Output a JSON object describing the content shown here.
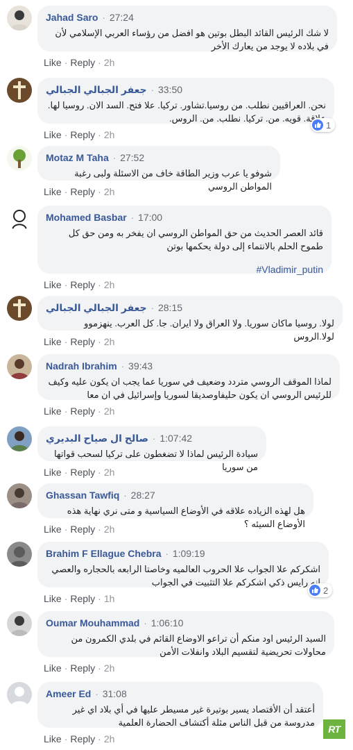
{
  "actions": {
    "like": "Like",
    "reply": "Reply"
  },
  "brand": {
    "like_badge_color": "#4a7ef6",
    "rt_color": "#6db33f",
    "rt_label": "RT"
  },
  "comments": [
    {
      "name": "Jahad Saro",
      "time": "27:24",
      "text": "لا شك الرئيس القائد البطل بوتين هو افضل من رؤساء العربي الإسلامي لأن في بلاده لا يوجد من يعارك الأخر",
      "age": "2h"
    },
    {
      "name": "جعفر الجبالي الجبالي",
      "time": "33:50",
      "text": "نحن. العراقيين نطلب. من روسيا.تشاور. تركيا. علا فتح. السد الان. روسيا لها. علاقة. قويه. من. تركيا. نطلب. من. الروس.",
      "age": "2h",
      "reactions": "1"
    },
    {
      "name": "Motaz M Taha",
      "time": "27:52",
      "text": "شوفو يا عرب وزير الطاقة خاف من الاسئلة ولبى رغبة المواطن الروسي",
      "age": "2h"
    },
    {
      "name": "Mohamed Basbar",
      "time": "17:00",
      "text": "قائد العصر الحديث من حق المواطن الروسي ان يفخر به ومن حق كل طموح الحلم بالانتماء إلى دولة يحكمها بوتن",
      "hashtag": "#Vladimir_putin",
      "age": "2h"
    },
    {
      "name": "جعفر الجبالي الجبالي",
      "time": "28:15",
      "text": "لولا. روسيا ماكان سوريا. ولا العراق ولا ايران. جا. كل العرب. ينهزموو لولا.الروس",
      "age": "2h"
    },
    {
      "name": "Nadrah Ibrahim",
      "time": "39:43",
      "text": "لماذا الموقف الروسي متردد وضعيف في سوريا عما يجب ان يكون عليه وكيف للرئيس الروسي ان يكون حليفاوصديقا لسوريا وإسرائيل في ان معا",
      "age": "2h"
    },
    {
      "name": "صالح ال صياح البديري",
      "time": "1:07:42",
      "text": "سيادة الرئيس لماذا لا تضغطون على تركيا لسحب قواتها من سوريا",
      "age": "2h"
    },
    {
      "name": "Ghassan Tawfiq",
      "time": "28:27",
      "text": "هل لهذه الزياده علاقه في الأوضاع السياسية و متى نري نهاية هذه الأوضاع السيئه ؟",
      "age": "2h"
    },
    {
      "name": "Brahim F Ellague Chebra",
      "time": "1:09:19",
      "text": "اشكركم علا الجواب علا الحروب العالميه وخاصتا الرابعه بالحجاره والعصي انه رايس ذكي اشكركم علا التثبيت في الجواب",
      "age": "1h",
      "reactions": "2"
    },
    {
      "name": "Oumar Mouhammad",
      "time": "1:06:10",
      "text": "السيد الرئيس اود منكم أن تراعو الاوضاع القائم في بلدي الكمرون من محاولات تحريضية لتقسيم البلاد وانفلات الأمن",
      "age": "2h"
    },
    {
      "name": "Ameer Ed",
      "time": "31:08",
      "text": "أعتقد أن الأقتصاد يسير بوتيرة غير مسيطر عليها في أي بلاد اي غير مدروسة من قبل الناس مثلة أكتشاف الحضارة العلمية",
      "age": "2h"
    }
  ]
}
